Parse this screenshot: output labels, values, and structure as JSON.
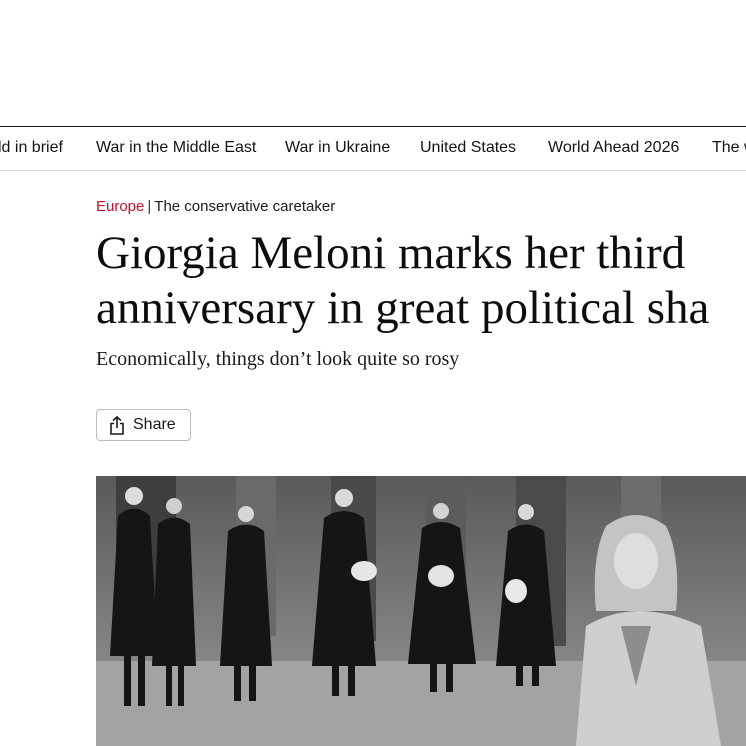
{
  "nav": {
    "items": [
      {
        "label": "ld in brief"
      },
      {
        "label": "War in the Middle East"
      },
      {
        "label": "War in Ukraine"
      },
      {
        "label": "United States"
      },
      {
        "label": "World Ahead 2026"
      },
      {
        "label": "The w"
      }
    ]
  },
  "article": {
    "section": "Europe",
    "separator": "|",
    "flytitle": "The conservative caretaker",
    "headline_line1": "Giorgia Meloni marks her third",
    "headline_line2": "anniversary in great political sha",
    "subheadline": "Economically, things don’t look quite so rosy",
    "share_label": "Share"
  },
  "colors": {
    "section_red": "#c8102e",
    "text": "#0d0d0d",
    "rule": "#1a1a1a"
  },
  "icons": {
    "share": "share-icon"
  }
}
